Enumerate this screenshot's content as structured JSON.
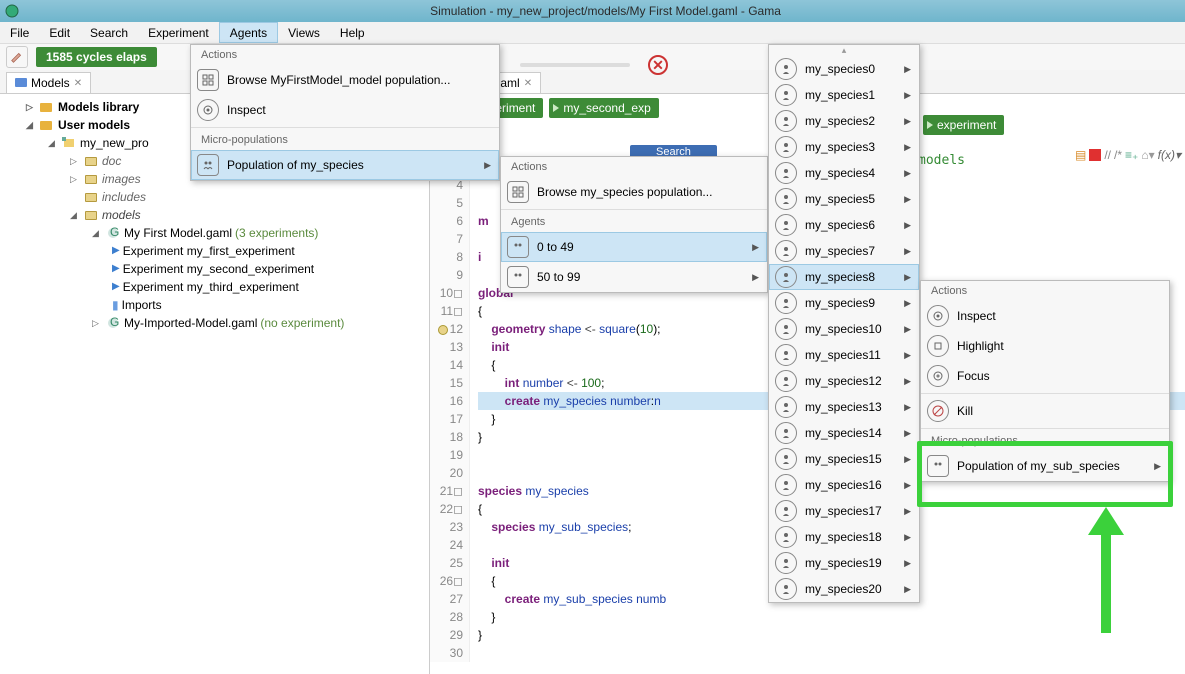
{
  "window": {
    "title": "Simulation - my_new_project/models/My First Model.gaml - Gama"
  },
  "menubar": {
    "file": "File",
    "edit": "Edit",
    "search": "Search",
    "experiment": "Experiment",
    "agents": "Agents",
    "views": "Views",
    "help": "Help"
  },
  "toolbar": {
    "cycles": "1585 cycles elaps",
    "search_placeholder": "Search"
  },
  "tabs": {
    "models": "Models",
    "editor": "st Model.gaml"
  },
  "experiments": {
    "first": "first_experiment",
    "second": "my_second_exp",
    "third": "experiment"
  },
  "tree": {
    "models_library": "Models library",
    "user_models": "User models",
    "project": "my_new_pro",
    "doc": "doc",
    "images": "images",
    "includes": "includes",
    "models": "models",
    "first_model": "My First Model.gaml",
    "first_model_note": "(3 experiments)",
    "exp1": "Experiment my_first_experiment",
    "exp2": "Experiment my_second_experiment",
    "exp3": "Experiment my_third_experiment",
    "imports": "Imports",
    "imported": "My-Imported-Model.gaml",
    "imported_note": "(no experiment)"
  },
  "dd_agents": {
    "actions_head": "Actions",
    "browse": "Browse MyFirstModel_model population...",
    "inspect": "Inspect",
    "micro_head": "Micro-populations",
    "pop": "Population of my_species"
  },
  "dd_sub1": {
    "actions_head": "Actions",
    "browse": "Browse my_species population...",
    "agents_head": "Agents",
    "range1": "0 to 49",
    "range2": "50 to 99"
  },
  "species_list": [
    "my_species0",
    "my_species1",
    "my_species2",
    "my_species3",
    "my_species4",
    "my_species5",
    "my_species6",
    "my_species7",
    "my_species8",
    "my_species9",
    "my_species10",
    "my_species11",
    "my_species12",
    "my_species13",
    "my_species14",
    "my_species15",
    "my_species16",
    "my_species17",
    "my_species18",
    "my_species19",
    "my_species20"
  ],
  "dd_actions": {
    "actions_head": "Actions",
    "inspect": "Inspect",
    "highlight": "Highlight",
    "focus": "Focus",
    "kill": "Kill",
    "micro_head": "Micro-populations",
    "pop_sub": "Population of my_sub_species"
  },
  "code": {
    "comment": "models",
    "model_kw": "m",
    "import_kw": "i",
    "global": "global",
    "geometry": "geometry",
    "shape": "shape",
    "square": "square",
    "sq_arg": "10",
    "init": "init",
    "int": "int",
    "number": "number",
    "hundred": "100",
    "create": "create",
    "my_species": "my_species",
    "number_kw": "number",
    "n": "n",
    "species": "species",
    "my_sub_species": "my_sub_species",
    "numb": "numb"
  }
}
